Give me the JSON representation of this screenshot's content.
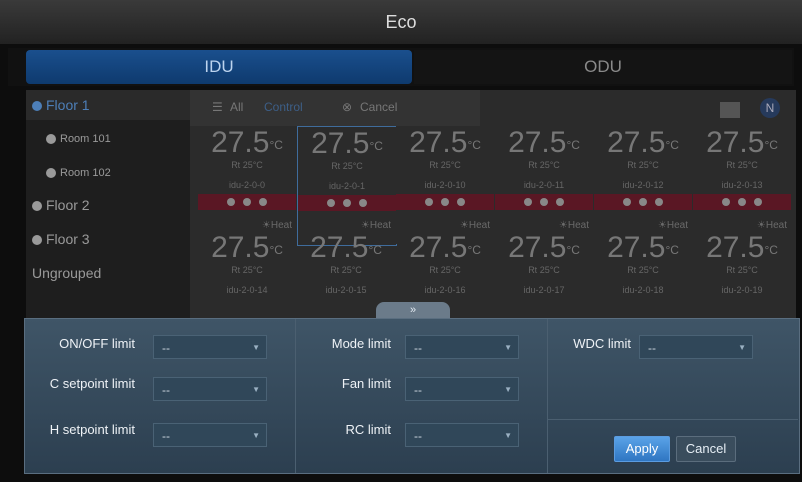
{
  "title": "Eco",
  "tabs": [
    {
      "label": "IDU"
    },
    {
      "label": "ODU"
    }
  ],
  "sidebar": {
    "items": [
      {
        "label": "Floor 1"
      },
      {
        "label": "Room 101"
      },
      {
        "label": "Room 102"
      },
      {
        "label": "Floor 2"
      },
      {
        "label": "Floor 3"
      },
      {
        "label": "Ungrouped"
      }
    ]
  },
  "toolbar": {
    "all_label": "All",
    "control_label": "Control",
    "cancel_label": "Cancel",
    "n_badge": "N"
  },
  "cards_row1": [
    {
      "temp": "27.5",
      "unit": "°C",
      "rt": "Rt 25°C",
      "name": "idu-2-0-0"
    },
    {
      "temp": "27.5",
      "unit": "°C",
      "rt": "Rt 25°C",
      "name": "idu-2-0-1"
    },
    {
      "temp": "27.5",
      "unit": "°C",
      "rt": "Rt 25°C",
      "name": "idu-2-0-10"
    },
    {
      "temp": "27.5",
      "unit": "°C",
      "rt": "Rt 25°C",
      "name": "idu-2-0-11"
    },
    {
      "temp": "27.5",
      "unit": "°C",
      "rt": "Rt 25°C",
      "name": "idu-2-0-12"
    },
    {
      "temp": "27.5",
      "unit": "°C",
      "rt": "Rt 25°C",
      "name": "idu-2-0-13"
    }
  ],
  "cards_row2": [
    {
      "mode": "Heat",
      "temp": "27.5",
      "unit": "°C",
      "rt": "Rt 25°C",
      "name": "idu-2-0-14"
    },
    {
      "mode": "Heat",
      "temp": "27.5",
      "unit": "°C",
      "rt": "Rt 25°C",
      "name": "idu-2-0-15"
    },
    {
      "mode": "Heat",
      "temp": "27.5",
      "unit": "°C",
      "rt": "Rt 25°C",
      "name": "idu-2-0-16"
    },
    {
      "mode": "Heat",
      "temp": "27.5",
      "unit": "°C",
      "rt": "Rt 25°C",
      "name": "idu-2-0-17"
    },
    {
      "mode": "Heat",
      "temp": "27.5",
      "unit": "°C",
      "rt": "Rt 25°C",
      "name": "idu-2-0-18"
    },
    {
      "mode": "Heat",
      "temp": "27.5",
      "unit": "°C",
      "rt": "Rt 25°C",
      "name": "idu-2-0-19"
    }
  ],
  "panel": {
    "onoff_label": "ON/OFF limit",
    "c_setpoint_label": "C setpoint limit",
    "h_setpoint_label": "H setpoint limit",
    "mode_label": "Mode limit",
    "fan_label": "Fan limit",
    "rc_label": "RC limit",
    "wdc_label": "WDC limit",
    "dd_value": "--",
    "apply": "Apply",
    "cancel": "Cancel"
  },
  "colors": {
    "accent": "#2f76c2",
    "panel": "#3f5567",
    "alarm_bar": "#5a1724"
  }
}
